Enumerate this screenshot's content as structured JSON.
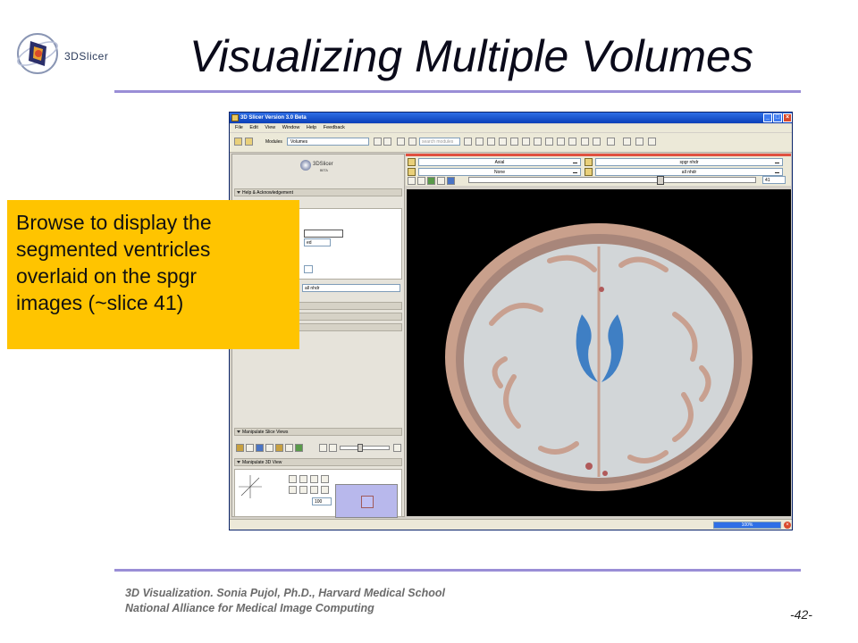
{
  "slide": {
    "title": "Visualizing Multiple Volumes",
    "logo_text": "3DSlicer",
    "footer_line1": "3D Visualization. Sonia Pujol, Ph.D., Harvard Medical School",
    "footer_line2": "National Alliance for Medical Image Computing",
    "page_number": "-42-"
  },
  "callout": {
    "text": "Browse to display the\nsegmented ventricles\noverlaid on the  spgr\nimages (~slice 41)"
  },
  "window": {
    "title": "3D Slicer Version 3.0 Beta",
    "menu": [
      "File",
      "Edit",
      "View",
      "Window",
      "Help",
      "Feedback"
    ],
    "modules_label": "Modules",
    "modules_value": "Volumes",
    "search_placeholder": "search modules"
  },
  "left_panel": {
    "logo_text": "3DSlicer",
    "logo_sub": "BETA",
    "help_section": "Help & Acknowledgement",
    "partial_option": "ed",
    "volume_value": "all nhdr",
    "slice_views_section": "Manipulate Slice Views",
    "view3d_section": "Manipulate 3D View",
    "zoom_value": "100"
  },
  "slice_controls": {
    "orientation": "Axial",
    "foreground_volume": "None",
    "background_volume": "spgr nhdr",
    "label_volume": "all nhdr",
    "slice_number": "41"
  },
  "status": {
    "progress_text": "100%",
    "progress": 1.0
  },
  "colors": {
    "accent_rule": "#9a8ed6",
    "callout_bg": "#ffc400",
    "titlebar": "#0a3fb8",
    "ventricle_label": "#3f7fc4",
    "skin_overlay": "#c8a090",
    "brain_tissue": "#cfd3d4"
  }
}
